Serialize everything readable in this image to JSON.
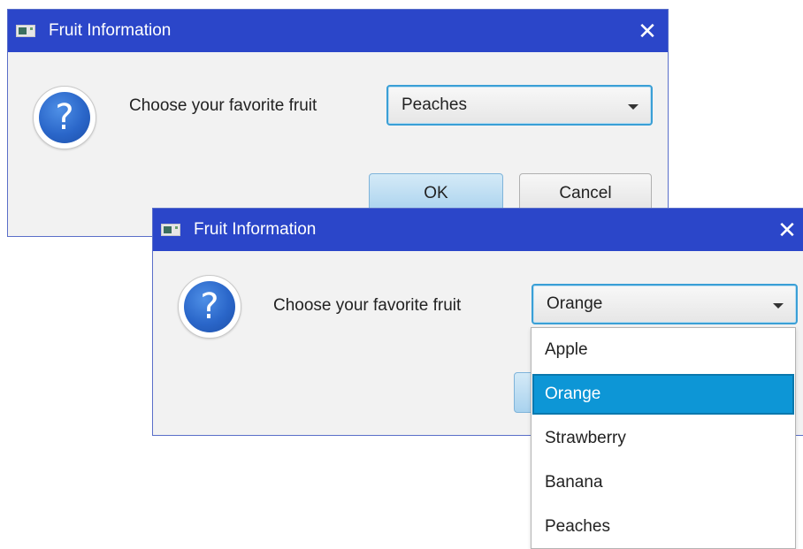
{
  "dialog_back": {
    "title": "Fruit Information",
    "close_glyph": "✕",
    "prompt": "Choose your favorite fruit",
    "combo_value": "Peaches",
    "ok_label": "OK",
    "cancel_label": "Cancel",
    "icon_glyph": "?"
  },
  "dialog_front": {
    "title": "Fruit Information",
    "close_glyph": "✕",
    "prompt": "Choose your favorite fruit",
    "combo_value": "Orange",
    "icon_glyph": "?",
    "dropdown": {
      "options": [
        "Apple",
        "Orange",
        "Strawberry",
        "Banana",
        "Peaches"
      ],
      "selected": "Orange"
    }
  },
  "colors": {
    "titlebar": "#2b46c9",
    "dialog_bg": "#f2f2f2",
    "focus_border": "#3a9fd6",
    "selection": "#0d96d6",
    "ok_button": "#a9d2ee"
  },
  "icons": {
    "app": "app-window-icon",
    "question": "question-icon",
    "close": "close-icon",
    "combo_arrow": "chevron-down-icon"
  }
}
